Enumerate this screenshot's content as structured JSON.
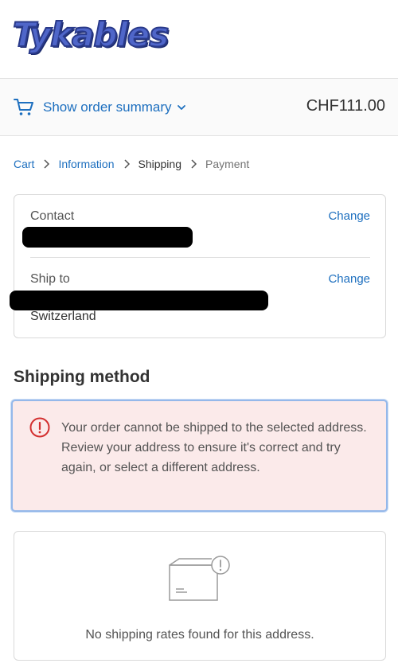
{
  "brand": {
    "logo_text": "Tykables"
  },
  "summary": {
    "toggle_label": "Show order summary",
    "total": "CHF111.00",
    "icons": [
      "cart-icon",
      "chevron-down-icon"
    ]
  },
  "breadcrumb": {
    "items": [
      "Cart",
      "Information",
      "Shipping",
      "Payment"
    ],
    "current": "Shipping"
  },
  "review": {
    "contact_label": "Contact",
    "contact_change": "Change",
    "shipto_label": "Ship to",
    "shipto_change": "Change",
    "country": "Switzerland"
  },
  "shipping_method": {
    "title": "Shipping method",
    "error": "Your order cannot be shipped to the selected address. Review your address to ensure it's correct and try again, or select a different address.",
    "empty": "No shipping rates found for this address."
  },
  "colors": {
    "link": "#1d6fbf",
    "alert_bg": "#fbeaea",
    "alert_border": "#94b8ea",
    "error_icon": "#d32f2f"
  }
}
